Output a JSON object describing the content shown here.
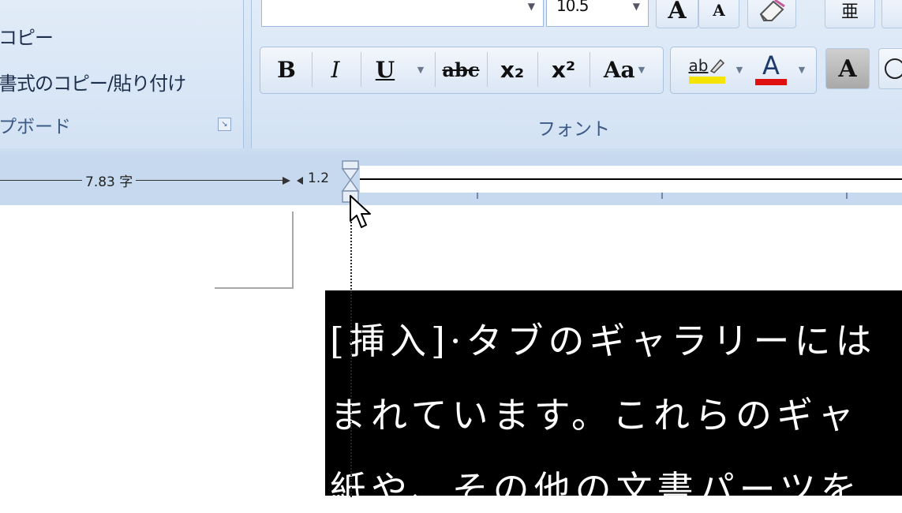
{
  "ribbon": {
    "clipboard": {
      "copy_label": "コピー",
      "format_painter_label": "書式のコピー/貼り付け",
      "group_label": "プボード"
    },
    "font": {
      "group_label": "フォント",
      "font_name_value": "",
      "font_size_value": "10.5",
      "grow_font_glyph": "A",
      "shrink_font_glyph": "A",
      "bold_glyph": "B",
      "italic_glyph": "I",
      "underline_glyph": "U",
      "strike_glyph": "abc",
      "subscript_glyph": "x₂",
      "superscript_glyph": "x²",
      "case_glyph": "Aa",
      "highlight_glyph": "ab",
      "font_color_glyph": "A",
      "char_shade_glyph": "A",
      "phonetic_glyph": "亜"
    }
  },
  "ruler": {
    "width_label": "7.83 字",
    "indent_label": "1.2"
  },
  "document": {
    "line1": "[挿入]·タブのギャラリーには",
    "line2": "まれています。これらのギャ",
    "line3": "紙や、その他の文書パーツを"
  },
  "colors": {
    "highlight": "#f5e400",
    "font_color": "#e01010",
    "ribbon_bg": "#d4e3f4",
    "ruler_bg": "#c7d9ee"
  }
}
